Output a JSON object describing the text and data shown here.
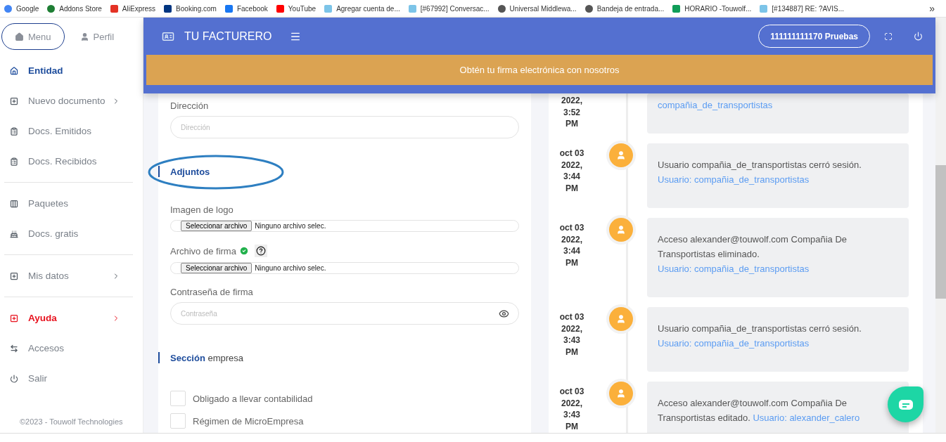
{
  "bookmarks": [
    {
      "label": "Google"
    },
    {
      "label": "Addons Store"
    },
    {
      "label": "AliExpress"
    },
    {
      "label": "Booking.com"
    },
    {
      "label": "Facebook"
    },
    {
      "label": "YouTube"
    },
    {
      "label": "Agregar cuenta de..."
    },
    {
      "label": "[#67992] Conversac..."
    },
    {
      "label": "Universal Middlewa..."
    },
    {
      "label": "Bandeja de entrada..."
    },
    {
      "label": "HORARIO -Touwolf..."
    },
    {
      "label": "[#134887] RE: ?AVIS..."
    }
  ],
  "bookmarks_overflow": "»",
  "sidebar": {
    "tabs": [
      {
        "label": "Menu",
        "selected": true
      },
      {
        "label": "Perfil",
        "selected": false
      }
    ],
    "groups": [
      [
        {
          "label": "Entidad",
          "selected": true,
          "submenu": false,
          "alert": false
        },
        {
          "label": "Nuevo documento",
          "selected": false,
          "submenu": true,
          "alert": false
        },
        {
          "label": "Docs. Emitidos",
          "selected": false,
          "submenu": false,
          "alert": false
        },
        {
          "label": "Docs. Recibidos",
          "selected": false,
          "submenu": false,
          "alert": false
        }
      ],
      [
        {
          "label": "Paquetes",
          "selected": false,
          "submenu": false,
          "alert": false
        },
        {
          "label": "Docs. gratis",
          "selected": false,
          "submenu": false,
          "alert": false
        }
      ],
      [
        {
          "label": "Mis datos",
          "selected": false,
          "submenu": true,
          "alert": false
        }
      ],
      [
        {
          "label": "Ayuda",
          "selected": false,
          "submenu": true,
          "alert": true
        },
        {
          "label": "Accesos",
          "selected": false,
          "submenu": false,
          "alert": false
        },
        {
          "label": "Salir",
          "selected": false,
          "submenu": false,
          "alert": false
        }
      ]
    ],
    "footer": "©2023 - Touwolf Technologies"
  },
  "header": {
    "brand": "TU FACTURERO",
    "account": "111111111170 Pruebas",
    "banner": "Obtén tu firma electrónica con nosotros"
  },
  "form": [
    {
      "kind": "text",
      "label": "Dirección",
      "placeholder": "Dirección"
    },
    {
      "kind": "section",
      "title": "**Adjuntos**",
      "annotated": true
    },
    {
      "kind": "file",
      "label": "Imagen de logo",
      "button": "Seleccionar archivo",
      "status": "Ninguno archivo selec.",
      "verified": false
    },
    {
      "kind": "file",
      "label": "Archivo de firma",
      "button": "Seleccionar archivo",
      "status": "Ninguno archivo selec.",
      "verified": true
    },
    {
      "kind": "password",
      "label": "Contraseña de firma",
      "placeholder": "Contraseña"
    },
    {
      "kind": "section",
      "title": "**Sección** empresa",
      "annotated": false
    },
    {
      "kind": "checkbox",
      "label": "Obligado a llevar contabilidad",
      "checked": false
    },
    {
      "kind": "checkbox",
      "label": "Régimen de MicroEmpresa",
      "checked": false
    }
  ],
  "timeline": [
    {
      "date": "2022, 3:52 PM",
      "avatar_visible": false,
      "link": "compañia_de_transportistas"
    },
    {
      "date": "oct 03 2022, 3:44 PM",
      "avatar_visible": true,
      "text": "Usuario compañia_de_transportistas cerró sesión.",
      "link": "Usuario: compañia_de_transportistas"
    },
    {
      "date": "oct 03 2022, 3:44 PM",
      "avatar_visible": true,
      "text": "Acceso alexander@touwolf.com Compañia De Transportistas eliminado.",
      "link": "Usuario: compañia_de_transportistas"
    },
    {
      "date": "oct 03 2022, 3:43 PM",
      "avatar_visible": true,
      "text": "Usuario compañia_de_transportistas cerró sesión.",
      "link": "Usuario: compañia_de_transportistas"
    },
    {
      "date": "oct 03 2022, 3:43 PM",
      "avatar_visible": true,
      "text": "Acceso alexander@touwolf.com Compañia De Transportistas editado.",
      "link": "Usuario: alexander_calero"
    }
  ]
}
